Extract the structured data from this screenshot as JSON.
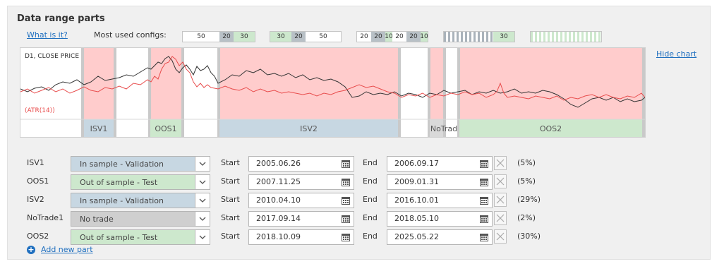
{
  "title": "Data range parts",
  "what_is_it": "What is it?",
  "most_used_label": "Most used configs:",
  "hide_chart": "Hide chart",
  "configs": [
    [
      "50",
      "20",
      "30"
    ],
    [
      "30",
      "20",
      "50"
    ],
    [
      "20",
      "20",
      "10",
      "20",
      "20",
      "10"
    ],
    [
      "30"
    ],
    []
  ],
  "chart": {
    "label_top": "D1, CLOSE PRICE",
    "label_bottom": "(ATR(14))",
    "colors": {
      "validation_band": "#ffcccc",
      "validation_label": "#c7d7e2",
      "test_label": "#cde8cd",
      "notrade_label": "#d9d9d9",
      "price_line": "#333333",
      "atr_line": "#e84c4c"
    },
    "bands": [
      {
        "label": "ISV1",
        "type": "validation"
      },
      {
        "label": "OOS1",
        "type": "test"
      },
      {
        "label": "ISV2",
        "type": "validation"
      },
      {
        "label": "NoTrad",
        "type": "notrade"
      },
      {
        "label": "OOS2",
        "type": "test"
      }
    ]
  },
  "parts": [
    {
      "name": "ISV1",
      "type": "In sample - Validation",
      "kind": "validation",
      "start": "2005.06.26",
      "end": "2006.09.17",
      "pct": "(5%)"
    },
    {
      "name": "OOS1",
      "type": "Out of sample - Test",
      "kind": "test",
      "start": "2007.11.25",
      "end": "2009.01.31",
      "pct": "(5%)"
    },
    {
      "name": "ISV2",
      "type": "In sample - Validation",
      "kind": "validation",
      "start": "2010.04.10",
      "end": "2016.10.01",
      "pct": "(29%)"
    },
    {
      "name": "NoTrade1",
      "type": "No trade",
      "kind": "notrade",
      "start": "2017.09.14",
      "end": "2018.05.10",
      "pct": "(2%)"
    },
    {
      "name": "OOS2",
      "type": "Out of sample - Test",
      "kind": "test",
      "start": "2018.10.09",
      "end": "2025.05.22",
      "pct": "(30%)"
    }
  ],
  "labels": {
    "start": "Start",
    "end": "End"
  },
  "add_new_part": "Add new part"
}
